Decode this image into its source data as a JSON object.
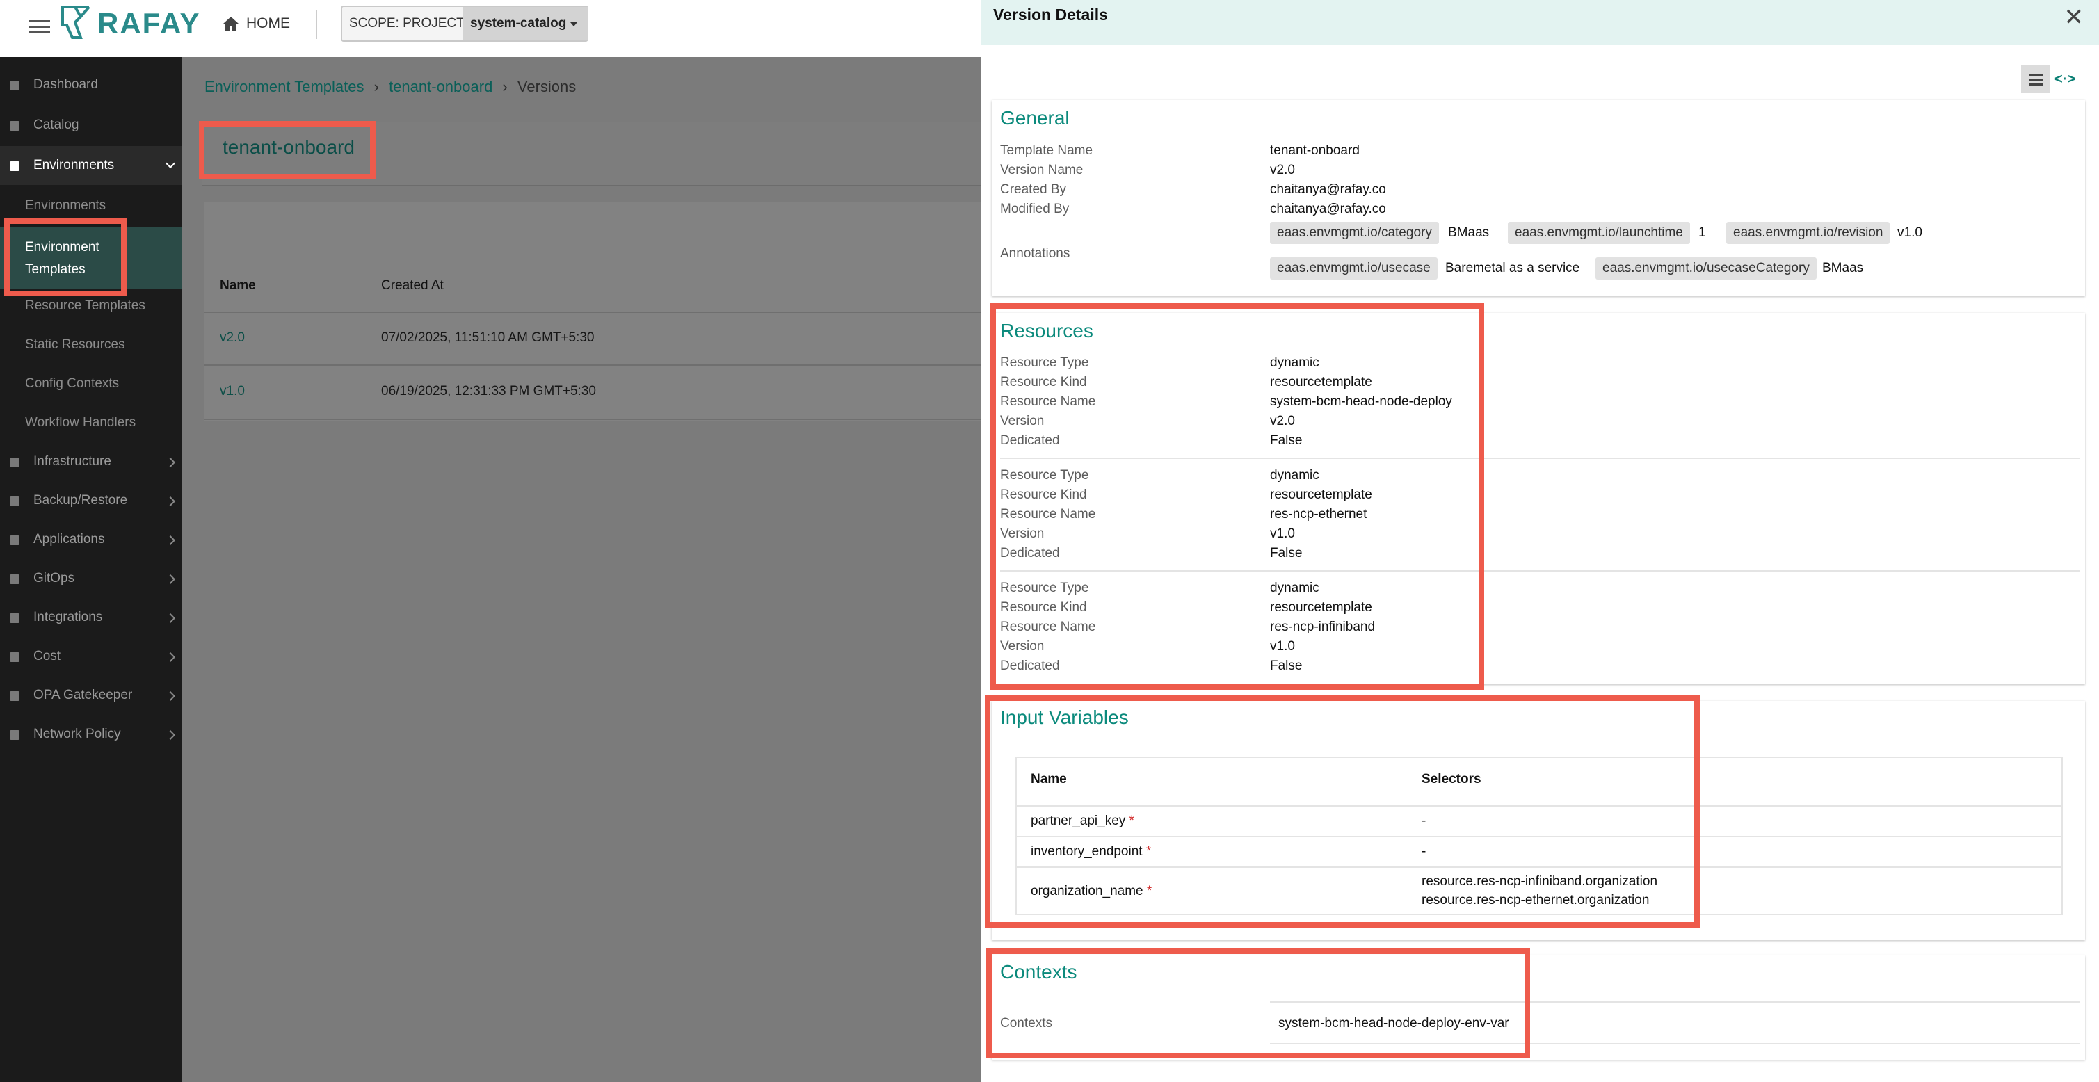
{
  "brand": "RAFAY",
  "topbar": {
    "home_label": "HOME",
    "scope_label": "SCOPE: PROJECT",
    "scope_value": "system-catalog"
  },
  "sidebar": {
    "items": [
      {
        "label": "Dashboard"
      },
      {
        "label": "Catalog"
      },
      {
        "label": "Environments"
      },
      {
        "label": "Infrastructure"
      },
      {
        "label": "Backup/Restore"
      },
      {
        "label": "Applications"
      },
      {
        "label": "GitOps"
      },
      {
        "label": "Integrations"
      },
      {
        "label": "Cost"
      },
      {
        "label": "OPA Gatekeeper"
      },
      {
        "label": "Network Policy"
      }
    ],
    "sub_items": [
      {
        "label": "Environments"
      },
      {
        "label": "Environment"
      },
      {
        "label": "Templates"
      },
      {
        "label": "Resource Templates"
      },
      {
        "label": "Static Resources"
      },
      {
        "label": "Config Contexts"
      },
      {
        "label": "Workflow Handlers"
      }
    ]
  },
  "breadcrumb": {
    "c1": "Environment Templates",
    "c2": "tenant-onboard",
    "sep": "›",
    "last": "Versions"
  },
  "page_title": "tenant-onboard",
  "versions_table": {
    "headers": {
      "name": "Name",
      "created_at": "Created At"
    },
    "rows": [
      {
        "name": "v2.0",
        "created_at": "07/02/2025, 11:51:10 AM GMT+5:30"
      },
      {
        "name": "v1.0",
        "created_at": "06/19/2025, 12:31:33 PM GMT+5:30"
      }
    ]
  },
  "panel": {
    "title": "Version Details",
    "close_glyph": "✕",
    "code_view_glyph": "<·>",
    "general": {
      "title": "General",
      "labels": {
        "template_name": "Template Name",
        "version_name": "Version Name",
        "created_by": "Created By",
        "modified_by": "Modified By",
        "annotations": "Annotations"
      },
      "template_name": "tenant-onboard",
      "version_name": "v2.0",
      "created_by": "chaitanya@rafay.co",
      "modified_by": "chaitanya@rafay.co",
      "annotations": [
        {
          "key": "eaas.envmgmt.io/category",
          "value": "BMaas"
        },
        {
          "key": "eaas.envmgmt.io/launchtime",
          "value": "1"
        },
        {
          "key": "eaas.envmgmt.io/revision",
          "value": "v1.0"
        },
        {
          "key": "eaas.envmgmt.io/usecase",
          "value": "Baremetal as a service"
        },
        {
          "key": "eaas.envmgmt.io/usecaseCategory",
          "value": "BMaas"
        }
      ]
    },
    "resources": {
      "title": "Resources",
      "labels": {
        "type": "Resource Type",
        "kind": "Resource Kind",
        "name": "Resource Name",
        "version": "Version",
        "dedicated": "Dedicated"
      },
      "items": [
        {
          "type": "dynamic",
          "kind": "resourcetemplate",
          "name": "system-bcm-head-node-deploy",
          "version": "v2.0",
          "dedicated": "False"
        },
        {
          "type": "dynamic",
          "kind": "resourcetemplate",
          "name": "res-ncp-ethernet",
          "version": "v1.0",
          "dedicated": "False"
        },
        {
          "type": "dynamic",
          "kind": "resourcetemplate",
          "name": "res-ncp-infiniband",
          "version": "v1.0",
          "dedicated": "False"
        }
      ]
    },
    "input_variables": {
      "title": "Input Variables",
      "headers": {
        "name": "Name",
        "selectors": "Selectors"
      },
      "required_mark": "*",
      "rows": [
        {
          "name": "partner_api_key",
          "selector1": "-",
          "selector2": ""
        },
        {
          "name": "inventory_endpoint",
          "selector1": "-",
          "selector2": ""
        },
        {
          "name": "organization_name",
          "selector1": "resource.res-ncp-infiniband.organization",
          "selector2": "resource.res-ncp-ethernet.organization"
        }
      ]
    },
    "contexts": {
      "title": "Contexts",
      "label": "Contexts",
      "value": "system-bcm-head-node-deploy-env-var"
    }
  },
  "colors": {
    "accent": "#0b8a7c",
    "highlight": "#ee5b4c",
    "sidebar_bg": "#1b1b1b",
    "required": "#d32f2f"
  }
}
